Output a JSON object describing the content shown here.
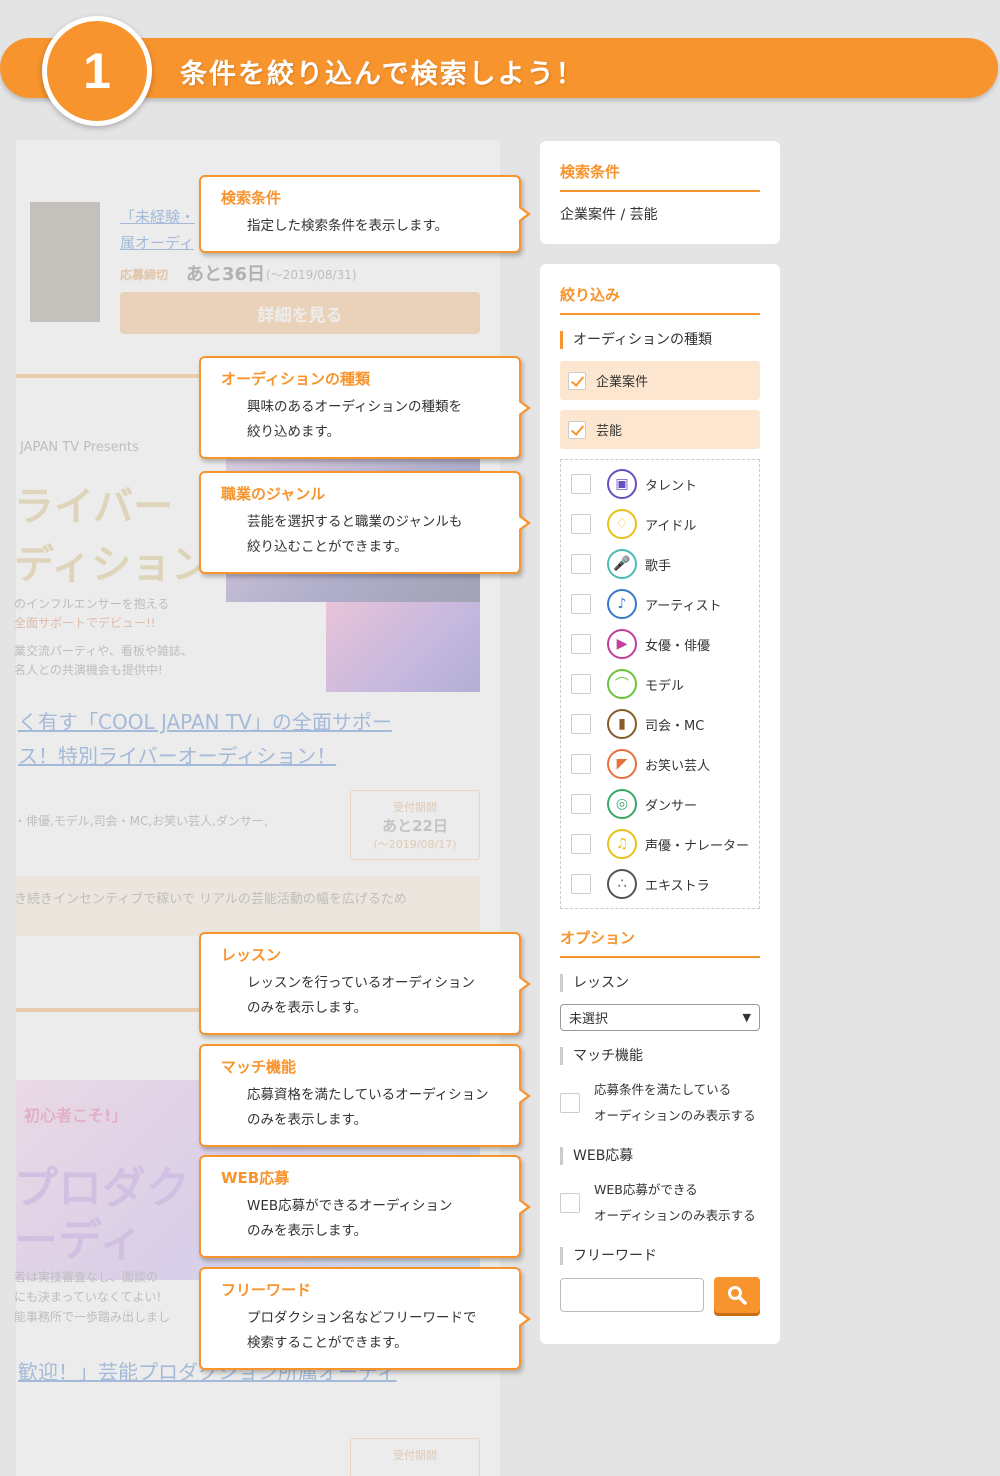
{
  "banner": {
    "step": "1",
    "title": "条件を絞り込んで検索しよう！"
  },
  "background": {
    "link1": "「未経験・",
    "link1b": "属オーディ",
    "deadline_label": "応募締切",
    "deadline_value": "あと36日",
    "deadline_date": "(〜2019/08/31)",
    "detail_button": "詳細を見る",
    "presents": "JAPAN TV  Presents",
    "big1": "ライバー",
    "big2": "ディション",
    "promo1": "のインフルエンサーを抱える",
    "promo2": "全面サポートでデビュー!!",
    "promo3": "業交流パーティや、看板や雑誌、",
    "promo4": "名人との共演機会も提供中!",
    "headline1": "く有す「COOL JAPAN TV」の全面サポー",
    "headline2": "ス！特別ライバーオーディション！",
    "genres": "・俳優,モデル,司会・MC,お笑い芸人,ダンサー,",
    "period_label": "受付期間",
    "period_value": "あと22日",
    "period_date": "(〜2019/08/17)",
    "desc": "き続きインセンティブで稼いで リアルの芸能活動の幅を広げるため",
    "beginner": "初心者こそ!」",
    "big3": "プロダク",
    "big4": "ーディ",
    "small1": "者は実技審査なし、面談の",
    "small2": "にも決まっていなくてよい!",
    "small3": "能事務所で一歩踏み出しまし",
    "headline3": "歓迎！」芸能プロダクション所属オーディ",
    "period_label2": "受付期間"
  },
  "callouts": [
    {
      "title": "検索条件",
      "desc": "指定した検索条件を表示します。"
    },
    {
      "title": "オーディションの種類",
      "desc": "興味のあるオーディションの種類を\n絞り込めます。"
    },
    {
      "title": "職業のジャンル",
      "desc": "芸能を選択すると職業のジャンルも\n絞り込むことができます。"
    },
    {
      "title": "レッスン",
      "desc": "レッスンを行っているオーディション\nのみを表示します。"
    },
    {
      "title": "マッチ機能",
      "desc": "応募資格を満たしているオーディション\nのみを表示します。"
    },
    {
      "title": "WEB応募",
      "desc": "WEB応募ができるオーディション\nのみを表示します。"
    },
    {
      "title": "フリーワード",
      "desc": "プロダクション名などフリーワードで\n検索することができます。"
    }
  ],
  "search_panel": {
    "heading": "検索条件",
    "current": "企業案件 / 芸能"
  },
  "filter_panel": {
    "heading": "絞り込み",
    "type_heading": "オーディションの種類",
    "types": [
      {
        "label": "企業案件",
        "checked": true
      },
      {
        "label": "芸能",
        "checked": true
      }
    ],
    "genres": [
      {
        "label": "タレント",
        "icon": "id-card-icon",
        "glyph": "▣",
        "color": "#6a4fc0"
      },
      {
        "label": "アイドル",
        "icon": "ribbon-icon",
        "glyph": "♢",
        "color": "#e8c21a"
      },
      {
        "label": "歌手",
        "icon": "microphone-icon",
        "glyph": "🎤",
        "color": "#4bbab8"
      },
      {
        "label": "アーティスト",
        "icon": "guitar-icon",
        "glyph": "♪",
        "color": "#3a78c9"
      },
      {
        "label": "女優・俳優",
        "icon": "movie-camera-icon",
        "glyph": "▶",
        "color": "#c0409a"
      },
      {
        "label": "モデル",
        "icon": "high-heel-icon",
        "glyph": "⌒",
        "color": "#6cc33a"
      },
      {
        "label": "司会・MC",
        "icon": "podium-icon",
        "glyph": "▮",
        "color": "#8a5a2b"
      },
      {
        "label": "お笑い芸人",
        "icon": "fan-icon",
        "glyph": "◤",
        "color": "#e8703a"
      },
      {
        "label": "ダンサー",
        "icon": "radio-icon",
        "glyph": "◎",
        "color": "#3aa86a"
      },
      {
        "label": "声優・ナレーター",
        "icon": "mic-stand-icon",
        "glyph": "♫",
        "color": "#e8c21a"
      },
      {
        "label": "エキストラ",
        "icon": "people-icon",
        "glyph": "∴",
        "color": "#555555"
      }
    ],
    "options_heading": "オプション",
    "lesson_heading": "レッスン",
    "lesson_value": "未選択",
    "match_heading": "マッチ機能",
    "match_label_1": "応募条件を満たしている",
    "match_label_2": "オーディションのみ表示する",
    "web_heading": "WEB応募",
    "web_label_1": "WEB応募ができる",
    "web_label_2": "オーディションのみ表示する",
    "freeword_heading": "フリーワード",
    "freeword_value": ""
  }
}
